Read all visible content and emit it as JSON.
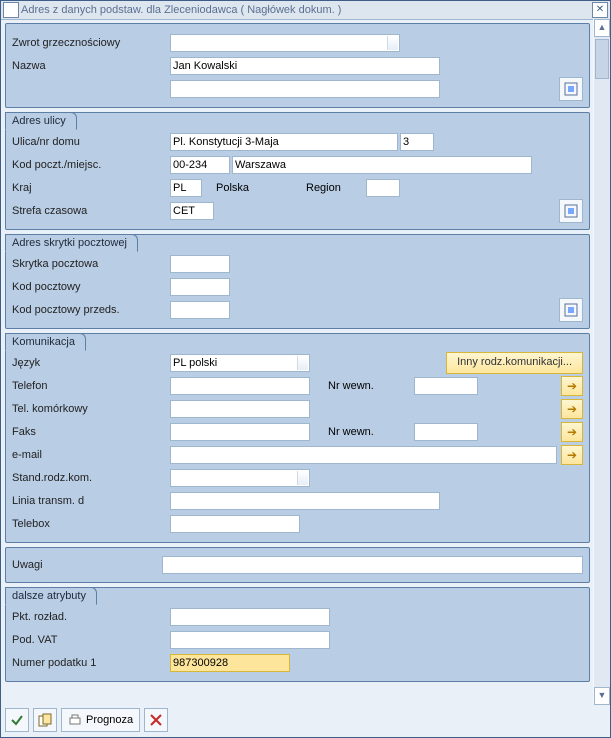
{
  "window": {
    "title": "Adres z danych podstaw. dla Zleceniodawca ( Nagłówek dokum. )"
  },
  "greeting": {
    "label": "Zwrot grzecznościowy",
    "value": ""
  },
  "name": {
    "label": "Nazwa",
    "value": "Jan Kowalski",
    "value2": ""
  },
  "address": {
    "tab": "Adres ulicy",
    "street_label": "Ulica/nr domu",
    "street_value": "Pl. Konstytucji 3-Maja",
    "house_no": "3",
    "postal_label": "Kod poczt./miejsc.",
    "postal_value": "00-234",
    "city_value": "Warszawa",
    "country_label": "Kraj",
    "country_code": "PL",
    "country_name": "Polska",
    "region_label": "Region",
    "region_value": "",
    "tz_label": "Strefa czasowa",
    "tz_value": "CET"
  },
  "pobox": {
    "tab": "Adres skrytki pocztowej",
    "box_label": "Skrytka pocztowa",
    "box_value": "",
    "postal_label": "Kod pocztowy",
    "postal_value": "",
    "company_postal_label": "Kod pocztowy przeds.",
    "company_postal_value": ""
  },
  "comm": {
    "tab": "Komunikacja",
    "lang_label": "Język",
    "lang_value": "PL polski",
    "more_comm": "Inny rodz.komunikacji...",
    "phone_label": "Telefon",
    "phone_value": "",
    "ext_label": "Nr wewn.",
    "phone_ext": "",
    "mobile_label": "Tel. komórkowy",
    "mobile_value": "",
    "fax_label": "Faks",
    "fax_value": "",
    "fax_ext": "",
    "email_label": "e-mail",
    "email_value": "",
    "std_label": "Stand.rodz.kom.",
    "std_value": "",
    "line_label": "Linia transm. d",
    "line_value": "",
    "telebox_label": "Telebox",
    "telebox_value": ""
  },
  "remarks": {
    "label": "Uwagi",
    "value": ""
  },
  "further": {
    "tab": "dalsze atrybuty",
    "unload_label": "Pkt. rozład.",
    "unload_value": "",
    "vat_label": "Pod. VAT",
    "vat_value": "",
    "tax1_label": "Numer podatku 1",
    "tax1_value": "987300928"
  },
  "toolbar": {
    "prognoza": "Prognoza"
  }
}
